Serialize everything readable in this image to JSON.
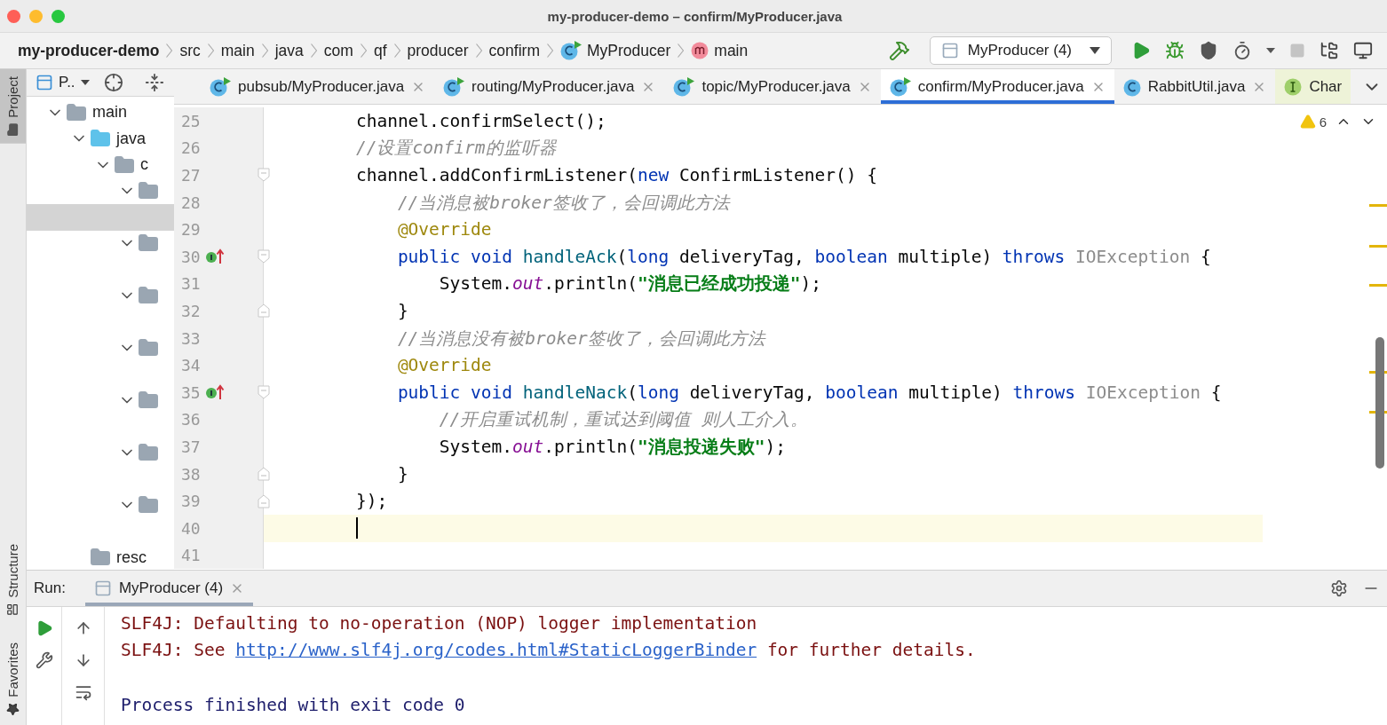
{
  "window": {
    "title": "my-producer-demo – confirm/MyProducer.java"
  },
  "breadcrumbs": [
    {
      "label": "my-producer-demo",
      "kind": "project"
    },
    {
      "label": "src",
      "kind": "folder"
    },
    {
      "label": "main",
      "kind": "folder"
    },
    {
      "label": "java",
      "kind": "folder"
    },
    {
      "label": "com",
      "kind": "folder"
    },
    {
      "label": "qf",
      "kind": "folder"
    },
    {
      "label": "producer",
      "kind": "folder"
    },
    {
      "label": "confirm",
      "kind": "folder"
    },
    {
      "label": "MyProducer",
      "kind": "class"
    },
    {
      "label": "main",
      "kind": "method"
    }
  ],
  "run_config": {
    "label": "MyProducer (4)"
  },
  "side_tabs": [
    {
      "label": "Project",
      "selected": true
    },
    {
      "label": "Structure",
      "selected": false
    },
    {
      "label": "Favorites",
      "selected": false
    }
  ],
  "project_panel": {
    "title": "P..",
    "tree": [
      {
        "label": "main",
        "kind": "folder",
        "expanded": true,
        "selected": false,
        "children": [
          {
            "label": "java",
            "kind": "source",
            "expanded": true,
            "selected": false,
            "children": [
              {
                "label": "c",
                "kind": "package",
                "expanded": true,
                "selected": false,
                "children": [
                  {
                    "kind": "package",
                    "expanded": true,
                    "selected": false,
                    "children": [
                      {
                        "selected": true
                      }
                    ]
                  },
                  {
                    "kind": "package",
                    "expanded": true,
                    "selected": false,
                    "children": [
                      {
                        "selected": false
                      }
                    ]
                  },
                  {
                    "kind": "package",
                    "expanded": true,
                    "selected": false,
                    "children": [
                      {
                        "selected": false
                      }
                    ]
                  },
                  {
                    "kind": "package",
                    "expanded": true,
                    "selected": false,
                    "children": [
                      {
                        "selected": false
                      }
                    ]
                  },
                  {
                    "kind": "package",
                    "expanded": true,
                    "selected": false,
                    "children": [
                      {
                        "selected": false
                      }
                    ]
                  },
                  {
                    "kind": "package",
                    "expanded": true,
                    "selected": false,
                    "children": [
                      {
                        "selected": false
                      }
                    ]
                  },
                  {
                    "kind": "package",
                    "expanded": true,
                    "selected": false,
                    "children": [
                      {
                        "selected": false
                      }
                    ]
                  }
                ]
              }
            ]
          },
          {
            "label": "resc",
            "kind": "resources",
            "selected": false
          }
        ]
      }
    ]
  },
  "editor_tabs": [
    {
      "label": "pubsub/MyProducer.java",
      "kind": "class",
      "selected": false
    },
    {
      "label": "routing/MyProducer.java",
      "kind": "class",
      "selected": false
    },
    {
      "label": "topic/MyProducer.java",
      "kind": "class",
      "selected": false
    },
    {
      "label": "confirm/MyProducer.java",
      "kind": "class",
      "selected": true
    },
    {
      "label": "RabbitUtil.java",
      "kind": "plain-class",
      "selected": false
    },
    {
      "label": "Char",
      "kind": "interface",
      "selected": false
    }
  ],
  "editor": {
    "warnings": "6",
    "lines": [
      {
        "number": "25",
        "current": false,
        "override": false,
        "fold_start": false,
        "fold_end": false,
        "segments": [
          {
            "kind": "plain",
            "text": "        channel.confirmSelect();"
          }
        ]
      },
      {
        "number": "26",
        "current": false,
        "override": false,
        "fold_start": false,
        "fold_end": false,
        "segments": [
          {
            "kind": "comment",
            "text": "        //设置confirm的监听器"
          }
        ]
      },
      {
        "number": "27",
        "current": false,
        "override": false,
        "fold_start": true,
        "fold_end": false,
        "segments": [
          {
            "kind": "plain",
            "text": "        channel.addConfirmListener("
          },
          {
            "kind": "keyword",
            "text": "new"
          },
          {
            "kind": "plain",
            "text": " ConfirmListener() {"
          }
        ]
      },
      {
        "number": "28",
        "current": false,
        "override": false,
        "fold_start": false,
        "fold_end": false,
        "segments": [
          {
            "kind": "comment",
            "text": "            //当消息被broker签收了，会回调此方法"
          }
        ]
      },
      {
        "number": "29",
        "current": false,
        "override": false,
        "fold_start": false,
        "fold_end": false,
        "segments": [
          {
            "kind": "annotation",
            "text": "            @Override"
          }
        ]
      },
      {
        "number": "30",
        "current": false,
        "override": true,
        "fold_start": true,
        "fold_end": false,
        "segments": [
          {
            "kind": "keyword",
            "text": "            public void "
          },
          {
            "kind": "method",
            "text": "handleAck"
          },
          {
            "kind": "plain",
            "text": "("
          },
          {
            "kind": "keyword",
            "text": "long"
          },
          {
            "kind": "plain",
            "text": " deliveryTag, "
          },
          {
            "kind": "keyword",
            "text": "boolean"
          },
          {
            "kind": "plain",
            "text": " multiple) "
          },
          {
            "kind": "keyword",
            "text": "throws "
          },
          {
            "kind": "unused",
            "text": "IOException"
          },
          {
            "kind": "plain",
            "text": " {"
          }
        ]
      },
      {
        "number": "31",
        "current": false,
        "override": false,
        "fold_start": false,
        "fold_end": false,
        "segments": [
          {
            "kind": "plain",
            "text": "                System."
          },
          {
            "kind": "field",
            "text": "out"
          },
          {
            "kind": "plain",
            "text": ".println("
          },
          {
            "kind": "string",
            "text": "\"消息已经成功投递\""
          },
          {
            "kind": "plain",
            "text": ");"
          }
        ]
      },
      {
        "number": "32",
        "current": false,
        "override": false,
        "fold_start": false,
        "fold_end": true,
        "segments": [
          {
            "kind": "plain",
            "text": "            }"
          }
        ]
      },
      {
        "number": "33",
        "current": false,
        "override": false,
        "fold_start": false,
        "fold_end": false,
        "segments": [
          {
            "kind": "comment",
            "text": "            //当消息没有被broker签收了，会回调此方法"
          }
        ]
      },
      {
        "number": "34",
        "current": false,
        "override": false,
        "fold_start": false,
        "fold_end": false,
        "segments": [
          {
            "kind": "annotation",
            "text": "            @Override"
          }
        ]
      },
      {
        "number": "35",
        "current": false,
        "override": true,
        "fold_start": true,
        "fold_end": false,
        "segments": [
          {
            "kind": "keyword",
            "text": "            public void "
          },
          {
            "kind": "method",
            "text": "handleNack"
          },
          {
            "kind": "plain",
            "text": "("
          },
          {
            "kind": "keyword",
            "text": "long"
          },
          {
            "kind": "plain",
            "text": " deliveryTag, "
          },
          {
            "kind": "keyword",
            "text": "boolean"
          },
          {
            "kind": "plain",
            "text": " multiple) "
          },
          {
            "kind": "keyword",
            "text": "throws "
          },
          {
            "kind": "unused",
            "text": "IOException"
          },
          {
            "kind": "plain",
            "text": " {"
          }
        ]
      },
      {
        "number": "36",
        "current": false,
        "override": false,
        "fold_start": false,
        "fold_end": false,
        "segments": [
          {
            "kind": "comment",
            "text": "                //开启重试机制，重试达到阈值 则人工介入。"
          }
        ]
      },
      {
        "number": "37",
        "current": false,
        "override": false,
        "fold_start": false,
        "fold_end": false,
        "segments": [
          {
            "kind": "plain",
            "text": "                System."
          },
          {
            "kind": "field",
            "text": "out"
          },
          {
            "kind": "plain",
            "text": ".println("
          },
          {
            "kind": "string",
            "text": "\"消息投递失败\""
          },
          {
            "kind": "plain",
            "text": ");"
          }
        ]
      },
      {
        "number": "38",
        "current": false,
        "override": false,
        "fold_start": false,
        "fold_end": true,
        "segments": [
          {
            "kind": "plain",
            "text": "            }"
          }
        ]
      },
      {
        "number": "39",
        "current": false,
        "override": false,
        "fold_start": false,
        "fold_end": true,
        "segments": [
          {
            "kind": "plain",
            "text": "        });"
          }
        ]
      },
      {
        "number": "40",
        "current": true,
        "override": false,
        "fold_start": false,
        "fold_end": false
      },
      {
        "number": "41",
        "current": false,
        "override": false,
        "fold_start": false,
        "fold_end": false
      }
    ]
  },
  "run_panel": {
    "label": "Run:",
    "tabs": [
      {
        "label": "MyProducer (4)",
        "selected": true
      }
    ],
    "console": [
      {
        "segments": [
          {
            "kind": "error",
            "text": "SLF4J: Defaulting to no-operation (NOP) logger implementation"
          }
        ]
      },
      {
        "segments": [
          {
            "kind": "error",
            "text": "SLF4J: See "
          },
          {
            "kind": "link",
            "text": "http://www.slf4j.org/codes.html#StaticLoggerBinder"
          },
          {
            "kind": "error",
            "text": " for further details."
          }
        ]
      },
      {
        "segments": [
          {
            "kind": "output",
            "text": "Process finished with exit code 0"
          }
        ]
      }
    ]
  }
}
